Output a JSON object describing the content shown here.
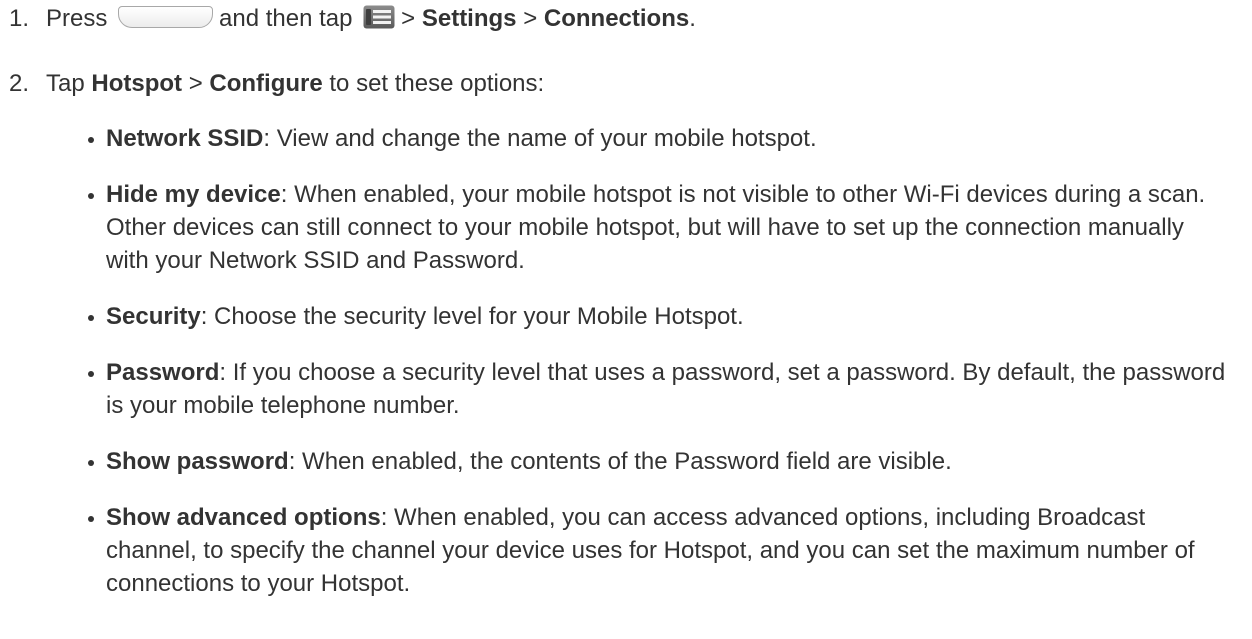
{
  "steps": [
    {
      "number": "1.",
      "press": "Press",
      "then_tap": "and then tap",
      "sep1": ">",
      "settings": "Settings",
      "sep2": ">",
      "connections": "Connections",
      "end": ".",
      "icons": [
        "home-key-icon",
        "menu-key-icon"
      ]
    },
    {
      "number": "2.",
      "tap": "Tap",
      "hotspot": "Hotspot",
      "sep": ">",
      "configure": "Configure",
      "rest": "to set these options:"
    }
  ],
  "options": [
    {
      "term": "Network SSID",
      "desc": ": View and change the name of your mobile hotspot."
    },
    {
      "term": "Hide my device",
      "desc": ": When enabled, your mobile hotspot is not visible to other Wi-Fi devices during a scan. Other devices can still connect to your mobile hotspot, but will have to set up the connection manually with your Network SSID and Password."
    },
    {
      "term": "Security",
      "desc": ": Choose the security level for your Mobile Hotspot."
    },
    {
      "term": "Password",
      "desc": ": If you choose a security level that uses a password, set a password. By default, the password is your mobile telephone number."
    },
    {
      "term": "Show password",
      "desc": ": When enabled, the contents of the Password field are visible."
    },
    {
      "term": "Show advanced options",
      "desc": ": When enabled, you can access advanced options, including Broadcast channel, to specify the channel your device uses for Hotspot, and you can set the maximum number of connections to your Hotspot."
    }
  ]
}
